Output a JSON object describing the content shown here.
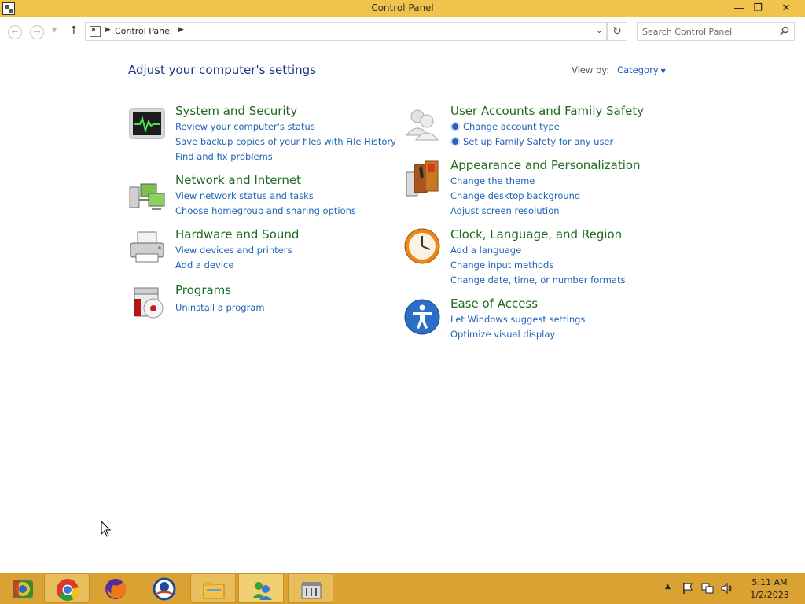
{
  "window": {
    "title": "Control Panel",
    "minimize": "—",
    "maximize": "❐",
    "close": "✕"
  },
  "address": {
    "back": "←",
    "forward": "→",
    "up": "↑",
    "crumb": "Control Panel",
    "refresh": "↻",
    "search_placeholder": "Search Control Panel"
  },
  "main": {
    "heading": "Adjust your computer's settings",
    "view_by_label": "View by:",
    "view_by_value": "Category"
  },
  "categories": [
    {
      "title": "System and Security",
      "icon": "system-security-icon",
      "links": [
        "Review your computer's status",
        "Save backup copies of your files with File History",
        "Find and fix problems"
      ]
    },
    {
      "title": "Network and Internet",
      "icon": "network-internet-icon",
      "links": [
        "View network status and tasks",
        "Choose homegroup and sharing options"
      ]
    },
    {
      "title": "Hardware and Sound",
      "icon": "hardware-sound-icon",
      "links": [
        "View devices and printers",
        "Add a device"
      ]
    },
    {
      "title": "Programs",
      "icon": "programs-icon",
      "links": [
        "Uninstall a program"
      ]
    },
    {
      "title": "User Accounts and Family Safety",
      "icon": "user-accounts-icon",
      "links": [
        "Change account type",
        "Set up Family Safety for any user"
      ]
    },
    {
      "title": "Appearance and Personalization",
      "icon": "appearance-icon",
      "links": [
        "Change the theme",
        "Change desktop background",
        "Adjust screen resolution"
      ]
    },
    {
      "title": "Clock, Language, and Region",
      "icon": "clock-icon",
      "links": [
        "Add a language",
        "Change input methods",
        "Change date, time, or number formats"
      ]
    },
    {
      "title": "Ease of Access",
      "icon": "ease-of-access-icon",
      "links": [
        "Let Windows suggest settings",
        "Optimize visual display"
      ]
    }
  ],
  "taskbar": {
    "apps": [
      "chrome-alt-icon",
      "chrome-icon",
      "firefox-icon",
      "obama-logo-icon",
      "file-explorer-icon",
      "people-app-icon",
      "control-panel-icon"
    ],
    "time": "5:11 AM",
    "date": "1/2/2023"
  },
  "colors": {
    "titlebar": "#f0c44c",
    "taskbar": "#d9a233",
    "heading": "#1e3287",
    "category_title": "#1e6b1e",
    "link": "#1e64b4"
  }
}
